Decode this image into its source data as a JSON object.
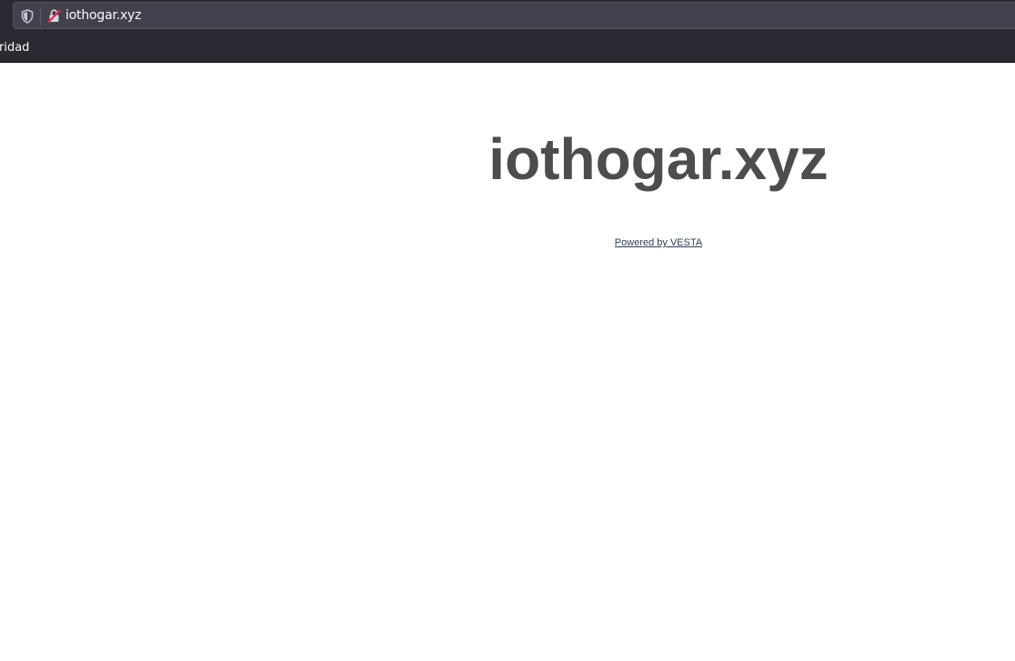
{
  "browser": {
    "url": "iothogar.xyz",
    "bookmarks": [
      {
        "label": "ridad"
      }
    ],
    "icons": {
      "tracking_protection": "shield-icon",
      "connection_security": "insecure-lock-icon"
    },
    "colors": {
      "chrome_background": "#2b2a33",
      "url_bar_background": "#42414d",
      "insecure_icon": "#e22850"
    }
  },
  "page": {
    "title": "iothogar.xyz",
    "powered_by_link": "Powered by VESTA",
    "colors": {
      "title": "#4d4d4d",
      "link": "#2c3e50",
      "background": "#ffffff"
    }
  }
}
